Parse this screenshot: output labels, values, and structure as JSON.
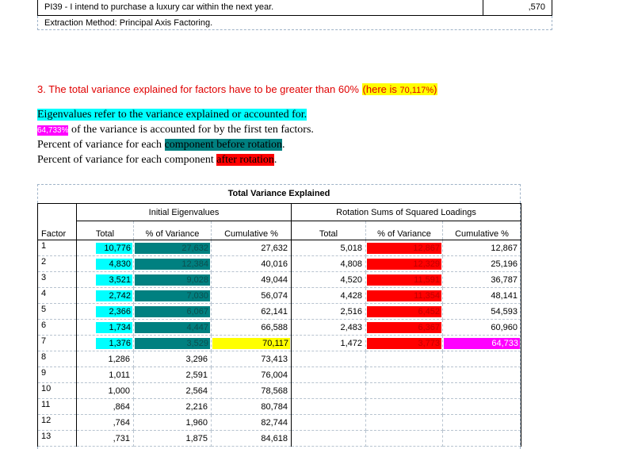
{
  "top_table": {
    "item_text": "PI39 - I intend to purchase a luxury car within the next year.",
    "item_value": ",570",
    "footnote": "Extraction Method: Principal Axis Factoring."
  },
  "note3": {
    "prefix": "3. The total variance explained for factors have to be greater than 60%",
    "highlight_text": "(here is ",
    "highlight_value": "70,117%",
    "highlight_close": ")"
  },
  "explanations": {
    "line1": "Eigenvalues refer to the variance explained or accounted for.",
    "line2_highlight": "64,733%",
    "line2_rest": " of the variance is accounted for by the first ten factors.",
    "line3_plain": "Percent of variance for each ",
    "line3_highlight": "component before rotation",
    "line3_end": ".",
    "line4_plain": "Percent of variance for each component ",
    "line4_highlight": "after rotation",
    "line4_end": "."
  },
  "table": {
    "title": "Total Variance Explained",
    "group_initial": "Initial Eigenvalues",
    "group_rotation": "Rotation Sums of Squared Loadings",
    "col_factor": "Factor",
    "col_total": "Total",
    "col_pct": "% of Variance",
    "col_cum": "Cumulative %",
    "rows": [
      {
        "factor": "1",
        "total": "10,776",
        "pct": "27,632",
        "cum": "27,632",
        "r_total": "5,018",
        "r_pct": "12,867",
        "r_cum": "12,867"
      },
      {
        "factor": "2",
        "total": "4,830",
        "pct": "12,384",
        "cum": "40,016",
        "r_total": "4,808",
        "r_pct": "12,329",
        "r_cum": "25,196"
      },
      {
        "factor": "3",
        "total": "3,521",
        "pct": "9,028",
        "cum": "49,044",
        "r_total": "4,520",
        "r_pct": "11,591",
        "r_cum": "36,787"
      },
      {
        "factor": "4",
        "total": "2,742",
        "pct": "7,030",
        "cum": "56,074",
        "r_total": "4,428",
        "r_pct": "11,354",
        "r_cum": "48,141"
      },
      {
        "factor": "5",
        "total": "2,366",
        "pct": "6,067",
        "cum": "62,141",
        "r_total": "2,516",
        "r_pct": "6,452",
        "r_cum": "54,593"
      },
      {
        "factor": "6",
        "total": "1,734",
        "pct": "4,447",
        "cum": "66,588",
        "r_total": "2,483",
        "r_pct": "6,367",
        "r_cum": "60,960"
      },
      {
        "factor": "7",
        "total": "1,376",
        "pct": "3,529",
        "cum": "70,117",
        "r_total": "1,472",
        "r_pct": "3,773",
        "r_cum": "64,733"
      },
      {
        "factor": "8",
        "total": "1,286",
        "pct": "3,296",
        "cum": "73,413",
        "r_total": "",
        "r_pct": "",
        "r_cum": ""
      },
      {
        "factor": "9",
        "total": "1,011",
        "pct": "2,591",
        "cum": "76,004",
        "r_total": "",
        "r_pct": "",
        "r_cum": ""
      },
      {
        "factor": "10",
        "total": "1,000",
        "pct": "2,564",
        "cum": "78,568",
        "r_total": "",
        "r_pct": "",
        "r_cum": ""
      },
      {
        "factor": "11",
        "total": ",864",
        "pct": "2,216",
        "cum": "80,784",
        "r_total": "",
        "r_pct": "",
        "r_cum": ""
      },
      {
        "factor": "12",
        "total": ",764",
        "pct": "1,960",
        "cum": "82,744",
        "r_total": "",
        "r_pct": "",
        "r_cum": ""
      },
      {
        "factor": "13",
        "total": ",731",
        "pct": "1,875",
        "cum": "84,618",
        "r_total": "",
        "r_pct": "",
        "r_cum": ""
      }
    ]
  },
  "colors": {
    "cyan": "#00ffff",
    "teal": "#008080",
    "red": "#ff0000",
    "yellow": "#ffff00",
    "magenta": "#ff00ff",
    "note_text": "#e00000"
  }
}
